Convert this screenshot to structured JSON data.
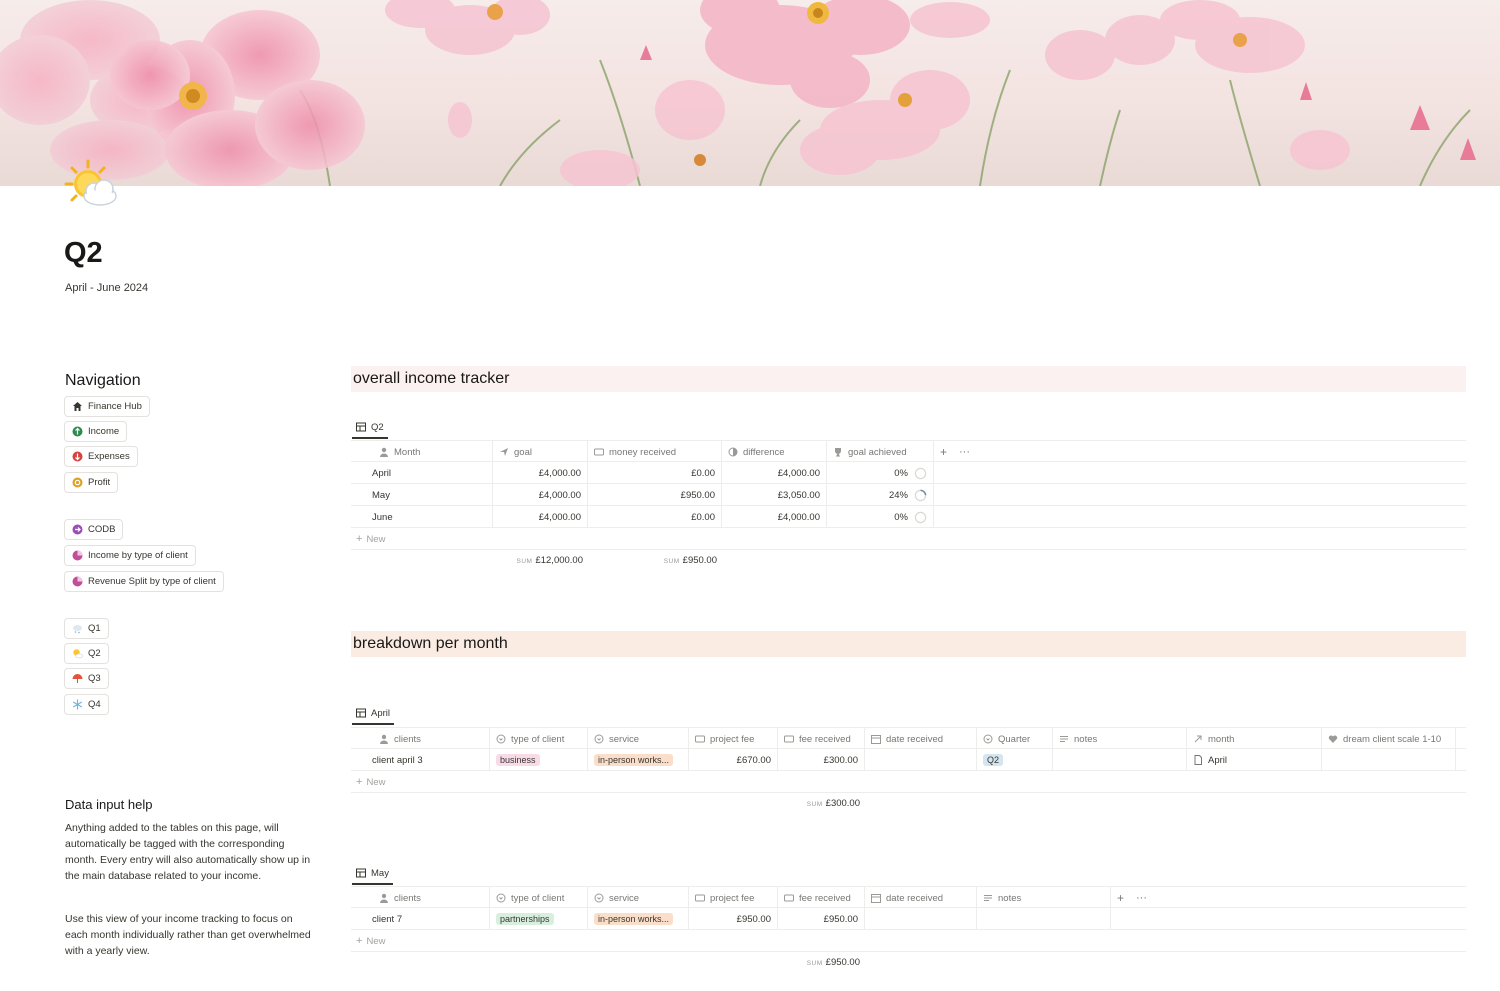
{
  "page": {
    "title": "Q2",
    "subtitle": "April - June 2024"
  },
  "nav": {
    "heading": "Navigation",
    "group1": [
      {
        "label": "Finance Hub",
        "icon": "house-icon"
      },
      {
        "label": "Income",
        "icon": "income-circle-icon"
      },
      {
        "label": "Expenses",
        "icon": "expenses-circle-icon"
      },
      {
        "label": "Profit",
        "icon": "profit-circle-icon"
      }
    ],
    "group2": [
      {
        "label": "CODB",
        "icon": "codb-circle-icon"
      },
      {
        "label": "Income by type of client",
        "icon": "pie-icon"
      },
      {
        "label": "Revenue Split by type of client",
        "icon": "pie-icon"
      }
    ],
    "group3": [
      {
        "label": "Q1",
        "icon": "snow-cloud-icon"
      },
      {
        "label": "Q2",
        "icon": "sun-cloud-icon"
      },
      {
        "label": "Q3",
        "icon": "umbrella-icon"
      },
      {
        "label": "Q4",
        "icon": "snowflake-icon"
      }
    ]
  },
  "help": {
    "heading": "Data input help",
    "p1": "Anything added to the tables on this page, will automatically be tagged with the corresponding month. Every entry will also automatically show up in the main database related to your income.",
    "p2": "Use this view of your income tracking to focus on each month individually rather than get overwhelmed with a yearly view."
  },
  "overall": {
    "heading": "overall income tracker",
    "heading_color": "#fbf1f1",
    "view_tab": "Q2",
    "columns": [
      "Month",
      "goal",
      "money received",
      "difference",
      "goal achieved"
    ],
    "rows": [
      {
        "month": "April",
        "goal": "£4,000.00",
        "received": "£0.00",
        "difference": "£4,000.00",
        "achieved": "0%",
        "achieved_value": 0
      },
      {
        "month": "May",
        "goal": "£4,000.00",
        "received": "£950.00",
        "difference": "£3,050.00",
        "achieved": "24%",
        "achieved_value": 0.24
      },
      {
        "month": "June",
        "goal": "£4,000.00",
        "received": "£0.00",
        "difference": "£4,000.00",
        "achieved": "0%",
        "achieved_value": 0
      }
    ],
    "new_label": "New",
    "sum_label": "SUM",
    "sum_goal": "£12,000.00",
    "sum_received": "£950.00"
  },
  "breakdown": {
    "heading": "breakdown per month",
    "heading_color": "#fbece3",
    "april": {
      "view_tab": "April",
      "columns": [
        "clients",
        "type of client",
        "service",
        "project fee",
        "fee received",
        "date received",
        "Quarter",
        "notes",
        "month",
        "dream client scale 1-10"
      ],
      "row": {
        "client": "client april 3",
        "type": "business",
        "service": "in-person works...",
        "fee": "£670.00",
        "received": "£300.00",
        "quarter": "Q2",
        "month": "April"
      },
      "new_label": "New",
      "sum_label": "SUM",
      "sum_received": "£300.00"
    },
    "may": {
      "view_tab": "May",
      "columns": [
        "clients",
        "type of client",
        "service",
        "project fee",
        "fee received",
        "date received",
        "notes"
      ],
      "row": {
        "client": "client 7",
        "type": "partnerships",
        "service": "in-person works...",
        "fee": "£950.00",
        "received": "£950.00"
      },
      "new_label": "New",
      "sum_label": "SUM",
      "sum_received": "£950.00"
    }
  },
  "colors": {
    "tag_business": "#f9dbe8",
    "tag_partnerships": "#d8efe0",
    "tag_service": "#fadec9",
    "tag_quarter": "#d3e5ef",
    "progress": "#6f8fa8"
  }
}
